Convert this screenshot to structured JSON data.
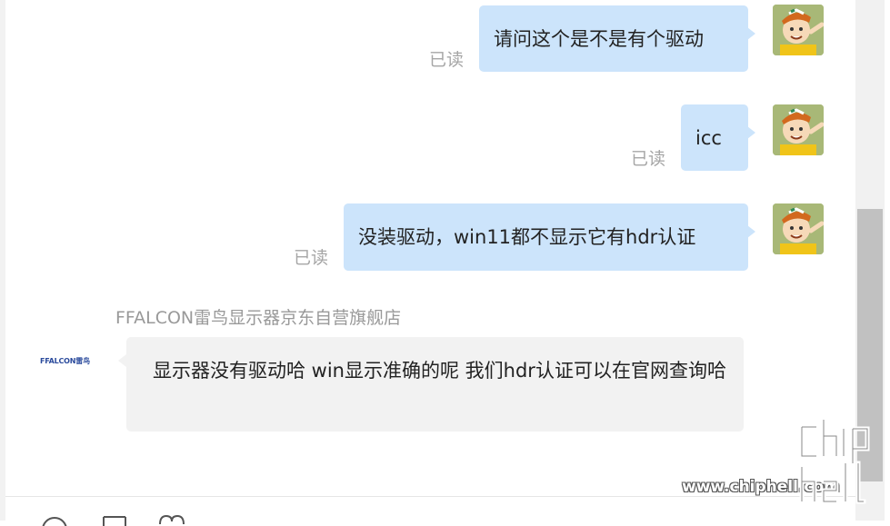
{
  "messages_out": [
    {
      "text": "请问这个是不是有个驱动",
      "status": "已读"
    },
    {
      "text": "icc",
      "status": "已读"
    },
    {
      "text": "没装驱动，win11都不显示它有hdr认证",
      "status": "已读"
    }
  ],
  "message_in": {
    "sender": "FFALCON雷鸟显示器京东自营旗舰店",
    "logo_text": "FFALCON雷鸟",
    "text": "显示器没有驱动哈 win显示准确的呢 我们hdr认证可以在官网查询哈"
  },
  "toolbar": {
    "icons": [
      "emoji-icon",
      "image-icon",
      "heart-icon"
    ]
  },
  "watermark": {
    "url": "www.chiphell.com",
    "logo": "chiphell"
  },
  "colors": {
    "bubble_out": "#cce4fb",
    "bubble_in": "#f2f2f2",
    "read_status": "#a6a6a6",
    "logo_blue": "#2a4a9c"
  }
}
